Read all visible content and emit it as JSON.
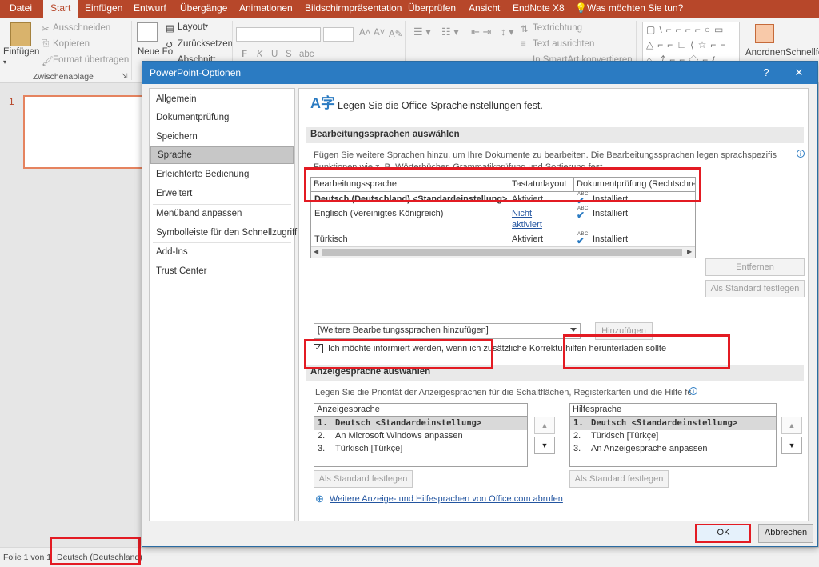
{
  "ribbon": {
    "tabs": [
      "Datei",
      "Start",
      "Einfügen",
      "Entwurf",
      "Übergänge",
      "Animationen",
      "Bildschirmpräsentation",
      "Überprüfen",
      "Ansicht",
      "EndNote X8"
    ],
    "active_tab": "Start",
    "tell_me": "Was möchten Sie tun?",
    "paste_label": "Einfügen",
    "cut_label": "Ausschneiden",
    "copy_label": "Kopieren",
    "format_painter_label": "Format übertragen",
    "clipboard_group": "Zwischenablage",
    "new_slide_label": "Neue Fo",
    "layout_label": "Layout",
    "reset_label": "Zurücksetzen",
    "section_label": "Abschnitt",
    "text_direction_label": "Textrichtung",
    "align_text_label": "Text ausrichten",
    "smartart_label": "In SmartArt konvertieren",
    "font_buttons": [
      "F",
      "K",
      "U",
      "S",
      "abc"
    ],
    "arrange_label": "Anordnen",
    "quickstyles_label": "Schnellfor"
  },
  "slides": {
    "number": "1"
  },
  "statusbar": {
    "slide_info": "Folie 1 von 1",
    "language": "Deutsch (Deutschland)"
  },
  "dialog": {
    "title": "PowerPoint-Optionen",
    "help": "?",
    "close": "✕",
    "nav": [
      "Allgemein",
      "Dokumentprüfung",
      "Speichern",
      "Sprache",
      "Erleichterte Bedienung",
      "Erweitert",
      "Menüband anpassen",
      "Symbolleiste für den Schnellzugriff",
      "Add-Ins",
      "Trust Center"
    ],
    "selected_nav": "Sprache",
    "heading": "Legen Sie die Office-Spracheinstellungen fest.",
    "editing_section": "Bearbeitungssprachen auswählen",
    "editing_desc_1": "Fügen Sie weitere Sprachen hinzu, um Ihre Dokumente zu bearbeiten. Die Bearbeitungssprachen legen sprachspezifische",
    "editing_desc_2": "Funktionen wie z. B. Wörterbücher, Grammatikprüfung und Sortierung fest.",
    "table_headers": [
      "Bearbeitungssprache",
      "Tastaturlayout",
      "Dokumentprüfung (Rechtschrei"
    ],
    "table_rows": [
      {
        "language": "Deutsch (Deutschland) <Standardeinstellung>",
        "keyboard": "Aktiviert",
        "proofing": "Installiert"
      },
      {
        "language": "Englisch (Vereinigtes Königreich)",
        "keyboard": "Nicht",
        "keyboard_2": "aktiviert",
        "proofing": "Installiert"
      },
      {
        "language": "Türkisch",
        "keyboard": "Aktiviert",
        "proofing": "Installiert"
      }
    ],
    "abc": "ABC",
    "remove_button": "Entfernen",
    "set_default_button": "Als Standard festlegen",
    "add_language_combo": "[Weitere Bearbeitungssprachen hinzufügen]",
    "add_button": "Hinzufügen",
    "notify_checkbox": "Ich möchte informiert werden, wenn ich zusätzliche Korrekturhilfen herunterladen sollte",
    "display_section": "Anzeigesprache auswählen",
    "display_desc": "Legen Sie die Priorität der Anzeigesprachen für die Schaltflächen, Registerkarten und die Hilfe fest",
    "display_header": "Anzeigesprache",
    "display_items": [
      {
        "num": "1.",
        "label": "Deutsch <Standardeinstellung>"
      },
      {
        "num": "2.",
        "label": "An Microsoft Windows anpassen"
      },
      {
        "num": "3.",
        "label": "Türkisch [Türkçe]"
      }
    ],
    "help_header": "Hilfesprache",
    "help_items": [
      {
        "num": "1.",
        "label": "Deutsch <Standardeinstellung>"
      },
      {
        "num": "2.",
        "label": "Türkisch [Türkçe]"
      },
      {
        "num": "3.",
        "label": "An Anzeigesprache anpassen"
      }
    ],
    "display_default_button": "Als Standard festlegen",
    "help_default_button": "Als Standard festlegen",
    "more_languages_link": "Weitere Anzeige- und Hilfesprachen von Office.com abrufen",
    "ok_button": "OK",
    "cancel_button": "Abbrechen"
  },
  "colors": {
    "accent": "#b7472a",
    "dialog_title": "#2b7bc2",
    "highlight": "#e31b23"
  }
}
